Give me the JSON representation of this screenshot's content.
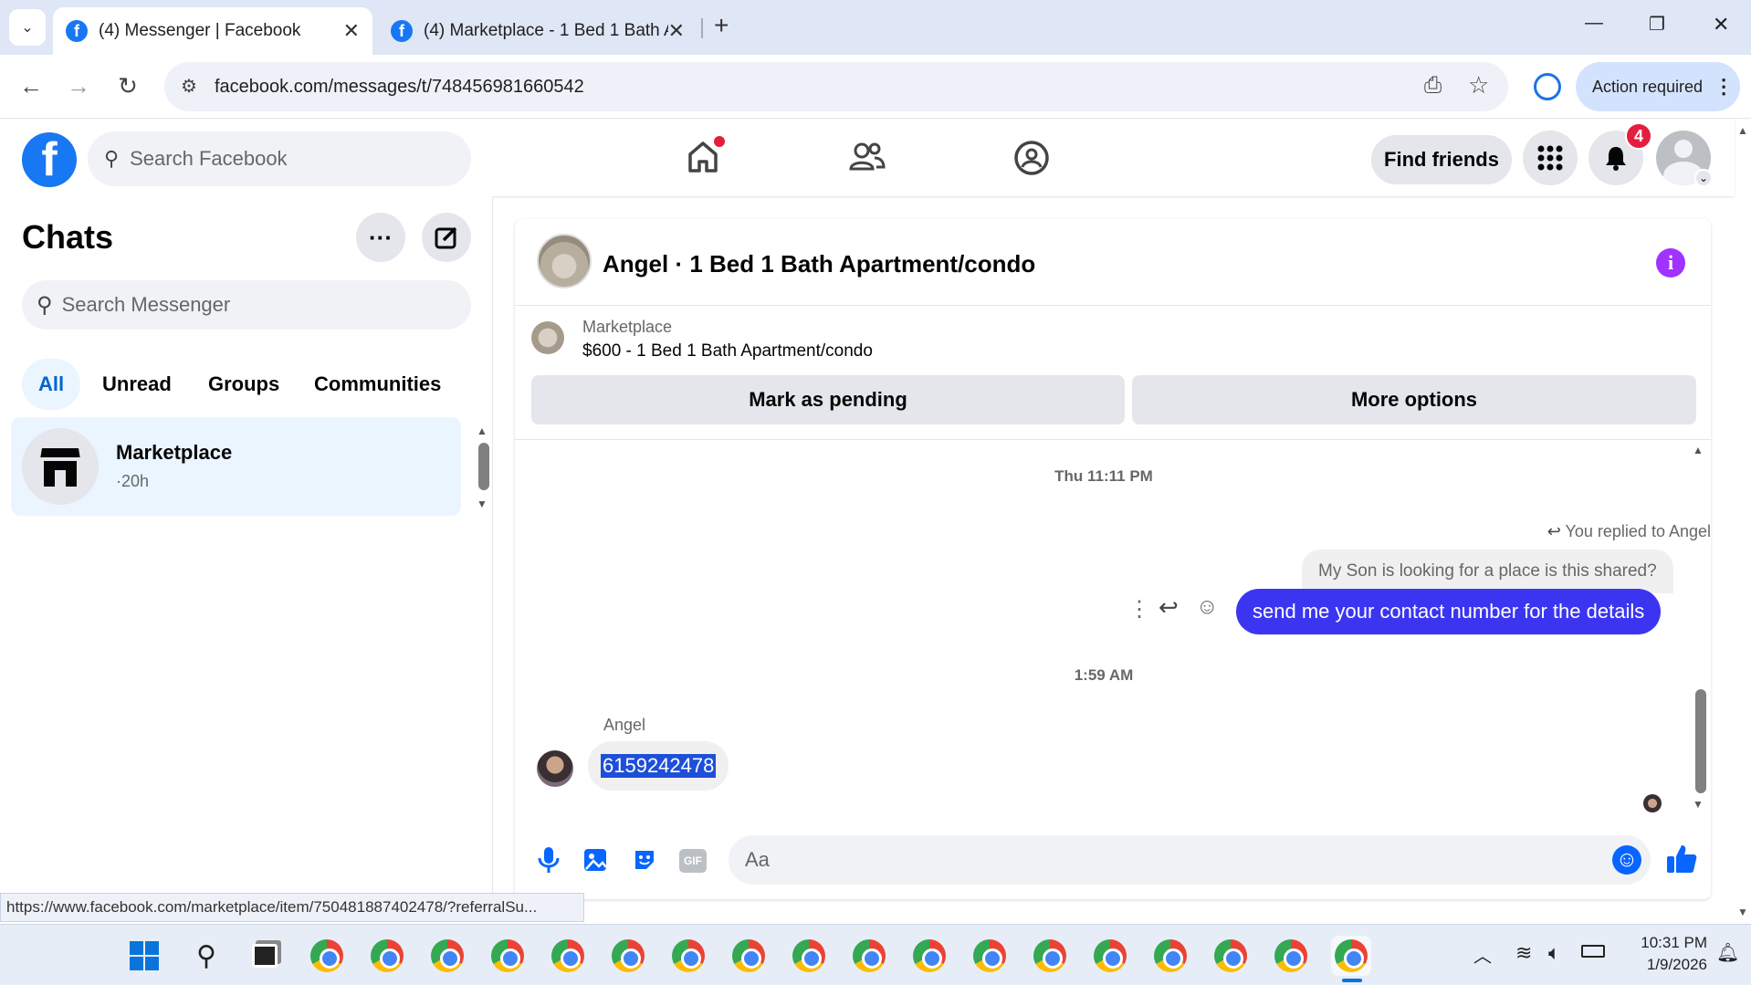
{
  "browser": {
    "tabs": [
      {
        "title": "(4) Messenger | Facebook",
        "active": true
      },
      {
        "title": "(4) Marketplace - 1 Bed 1 Bath A",
        "active": false
      }
    ],
    "new_tab": "+",
    "url": "facebook.com/messages/t/748456981660542",
    "action_required": "Action required",
    "window_controls": {
      "minimize": "—",
      "restore": "❐",
      "close": "✕"
    }
  },
  "facebook": {
    "search_placeholder": "Search Facebook",
    "find_friends": "Find friends",
    "notification_count": "4"
  },
  "chats": {
    "title": "Chats",
    "search_placeholder": "Search Messenger",
    "filters": [
      "All",
      "Unread",
      "Groups",
      "Communities"
    ],
    "items": [
      {
        "name": "Marketplace",
        "meta": "·20h"
      }
    ]
  },
  "conversation": {
    "title": "Angel · 1 Bed 1 Bath Apartment/condo",
    "marketplace_label": "Marketplace",
    "listing": "$600 - 1 Bed 1 Bath Apartment/condo",
    "mark_pending": "Mark as pending",
    "more_options": "More options",
    "timestamp1": "Thu 11:11 PM",
    "replied_to": "You replied to Angel",
    "quoted_message": "My Son is looking for a place is this shared?",
    "sent_message": "send me your contact number for the  details",
    "timestamp2": "1:59 AM",
    "sender_name": "Angel",
    "received_message": "6159242478",
    "composer_placeholder": "Aa"
  },
  "status_url": "https://www.facebook.com/marketplace/item/750481887402478/?referralSu...",
  "taskbar": {
    "time": "10:31 PM",
    "date": "1/9/2026"
  },
  "colors": {
    "fb_blue": "#1877f2",
    "sent_bubble": "#3b35f2",
    "received_bubble": "#f0f0f0",
    "selection": "#1d4fd8",
    "info_purple": "#a033ff",
    "badge_red": "#e41e3f"
  }
}
